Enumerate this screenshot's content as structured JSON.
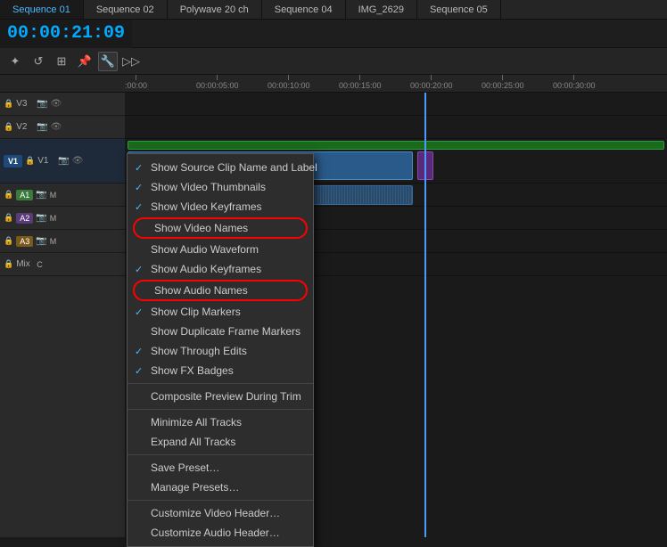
{
  "tabs": [
    {
      "label": "Sequence 01",
      "active": false
    },
    {
      "label": "Sequence 02",
      "active": false
    },
    {
      "label": "Polywave 20 ch",
      "active": false
    },
    {
      "label": "Sequence 04",
      "active": false
    },
    {
      "label": "IMG_2629",
      "active": false
    },
    {
      "label": "Sequence 05",
      "active": false
    }
  ],
  "timecode": "00:00:21:09",
  "toolbar": {
    "wrench_label": "🔧"
  },
  "ruler": {
    "marks": [
      {
        "time": ":00:00",
        "pos": 0
      },
      {
        "time": "00:00:05:00",
        "pos": 80
      },
      {
        "time": "00:00:10:00",
        "pos": 160
      },
      {
        "time": "00:00:15:00",
        "pos": 240
      },
      {
        "time": "00:00:20:00",
        "pos": 320
      },
      {
        "time": "00:00:25:00",
        "pos": 400
      },
      {
        "time": "00:00:30:00",
        "pos": 480
      }
    ]
  },
  "tracks": [
    {
      "label": "V3",
      "type": "video"
    },
    {
      "label": "V2",
      "type": "video"
    },
    {
      "label": "V1",
      "type": "video",
      "main": true
    },
    {
      "label": "A1",
      "type": "audio"
    },
    {
      "label": "A2",
      "type": "audio"
    },
    {
      "label": "A3",
      "type": "audio"
    },
    {
      "label": "Mix",
      "type": "mix"
    }
  ],
  "menu": {
    "items": [
      {
        "label": "Show Source Clip Name and Label",
        "checked": true,
        "separator_after": false
      },
      {
        "label": "Show Video Thumbnails",
        "checked": true,
        "separator_after": false
      },
      {
        "label": "Show Video Keyframes",
        "checked": true,
        "separator_after": false
      },
      {
        "label": "Show Video Names",
        "checked": false,
        "circled": true,
        "separator_after": false
      },
      {
        "label": "Show Audio Waveform",
        "checked": false,
        "separator_after": false
      },
      {
        "label": "Show Audio Keyframes",
        "checked": true,
        "separator_after": false
      },
      {
        "label": "Show Audio Names",
        "checked": false,
        "circled": true,
        "separator_after": false
      },
      {
        "label": "Show Clip Markers",
        "checked": true,
        "separator_after": false
      },
      {
        "label": "Show Duplicate Frame Markers",
        "checked": false,
        "separator_after": false
      },
      {
        "label": "Show Through Edits",
        "checked": true,
        "separator_after": false
      },
      {
        "label": "Show FX Badges",
        "checked": true,
        "separator_after": true
      },
      {
        "label": "Composite Preview During Trim",
        "checked": false,
        "separator_after": true
      },
      {
        "label": "Minimize All Tracks",
        "checked": false,
        "separator_after": false
      },
      {
        "label": "Expand All Tracks",
        "checked": false,
        "separator_after": true
      },
      {
        "label": "Save Preset…",
        "checked": false,
        "separator_after": false
      },
      {
        "label": "Manage Presets…",
        "checked": false,
        "separator_after": true
      },
      {
        "label": "Customize Video Header…",
        "checked": false,
        "separator_after": false
      },
      {
        "label": "Customize Audio Header…",
        "checked": false,
        "separator_after": false
      }
    ]
  }
}
